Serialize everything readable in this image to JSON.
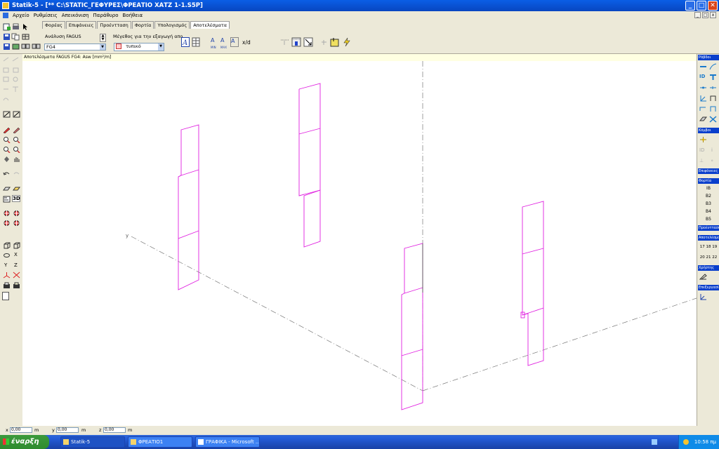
{
  "window": {
    "title": "Statik-5 - [** C:\\STATIC_ΓΕΦΥΡΕΣ\\ΦΡΕΑΤΙΟ ΧΑΤΖ 1-1.S5P]",
    "minimize": "_",
    "maximize": "□",
    "close": "✕"
  },
  "menu": [
    "Αρχείο",
    "Ρυθμίσεις",
    "Απεικόνιση",
    "Παράθυρο",
    "Βοήθεια"
  ],
  "tabs": [
    "Φορέας",
    "Επιφάνειες",
    "Προέντταση",
    "Φορτία",
    "Υπολογισμός",
    "Αποτελέσματα"
  ],
  "toolbar": {
    "analysis_label": "Ανάλυση FAGUS",
    "analysis_value": "FG4",
    "export_size_label": "Μέγεθος για την εξαγωγή απο",
    "export_size_value": "τυπικό",
    "xd_label": "x/d",
    "a_labels": [
      "MIN",
      "MAX",
      ""
    ]
  },
  "status": {
    "text": "Αποτελέσματα FAGUS FG4: Asw [mm²/m]"
  },
  "canvas": {
    "axis_y_label": "y"
  },
  "right_panel": {
    "headers": [
      "Ράβδοι",
      "Κόμβοι",
      "Επιφάνειες",
      "Φορτία",
      "Προέντταση",
      "Αποτελέσματα",
      "Χρήστης",
      "Επεξεργασία"
    ],
    "load_cases": [
      "ΙΒ",
      "Β2",
      "Β3",
      "Β4",
      "Β5"
    ],
    "result_numbers_row1": "17 18 19",
    "result_numbers_row2": "20 21 22"
  },
  "coords": {
    "x_label": "x",
    "x_value": "0,00",
    "x_unit": "m",
    "y_label": "y",
    "y_value": "0,00",
    "y_unit": "m",
    "z_label": "z",
    "z_value": "0,00",
    "z_unit": "m"
  },
  "taskbar": {
    "start": "έναρξη",
    "tasks": [
      "Statik-5",
      "ΦΡΕΑΤΙΟ1",
      "ΓΡΑΦΙΚΑ - Microsoft ..."
    ],
    "clock": "10:58 πμ"
  },
  "colors": {
    "element": "#e020e0",
    "axis": "#777777",
    "titlebar": "#0a5ee6",
    "panel_header": "#0a3fcc"
  }
}
